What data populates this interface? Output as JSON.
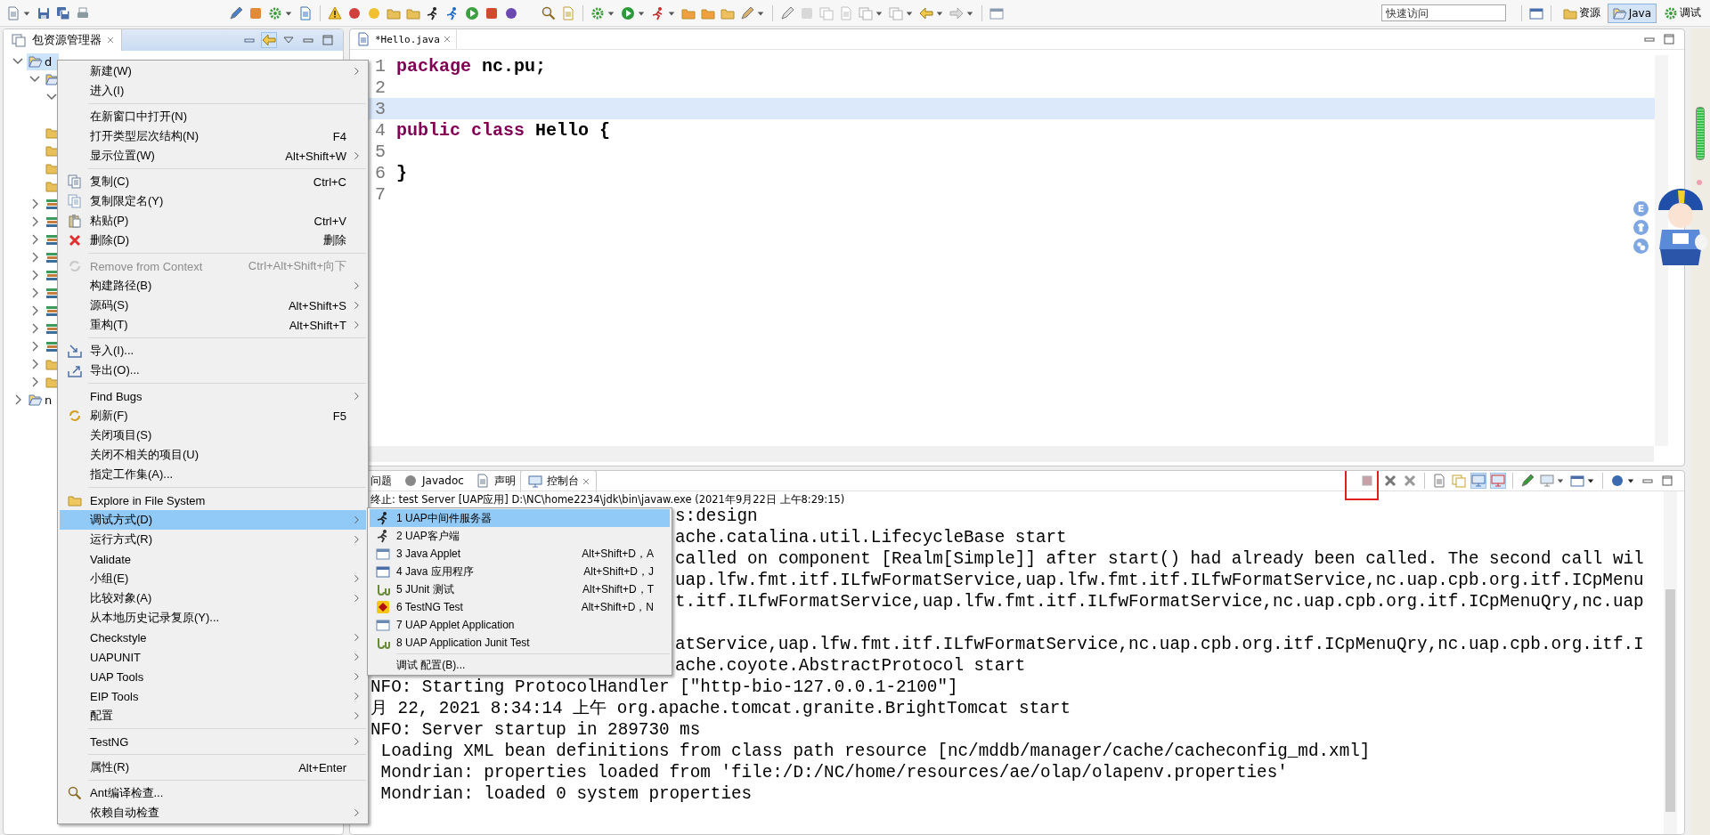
{
  "toolbar": {
    "quick_access": {
      "placeholder": "快速访问"
    },
    "perspectives": [
      {
        "label": "资源",
        "selected": false
      },
      {
        "label": "Java",
        "selected": true
      },
      {
        "label": "调试",
        "selected": false
      }
    ]
  },
  "package_explorer": {
    "title": "包资源管理器",
    "tree": [
      {
        "kind": "project",
        "label": "d",
        "expanded": true,
        "selected": true,
        "children": [
          {
            "kind": "package-folder",
            "expanded": true,
            "selected": false,
            "children": [
              {
                "expanded": true
              }
            ]
          },
          {
            "kind": "folder",
            "selected": false
          },
          {
            "kind": "folder",
            "selected": false
          },
          {
            "kind": "folder",
            "selected": false
          },
          {
            "kind": "folder",
            "selected": false
          },
          {
            "kind": "library",
            "expanded": false,
            "selected": false
          },
          {
            "kind": "library",
            "expanded": false,
            "selected": false
          },
          {
            "kind": "library",
            "expanded": false,
            "selected": false
          },
          {
            "kind": "library",
            "expanded": false,
            "selected": false
          },
          {
            "kind": "library",
            "expanded": false,
            "selected": false
          },
          {
            "kind": "library",
            "expanded": false,
            "selected": false
          },
          {
            "kind": "library",
            "expanded": false,
            "selected": false
          },
          {
            "kind": "library",
            "expanded": false,
            "selected": false
          },
          {
            "kind": "library",
            "expanded": false,
            "selected": false
          },
          {
            "kind": "folder",
            "expanded": false,
            "selected": false
          },
          {
            "kind": "folder",
            "expanded": false,
            "selected": false
          }
        ]
      },
      {
        "kind": "project",
        "label": "n",
        "expanded": false,
        "selected": false
      }
    ]
  },
  "editor": {
    "tab": {
      "title": "*Hello.java"
    },
    "lines": [
      {
        "number": "1",
        "current": false,
        "tokens": [
          {
            "kind": "keyword",
            "text": "package"
          },
          {
            "kind": "plain",
            "text": " nc.pu;"
          }
        ]
      },
      {
        "number": "2",
        "current": false
      },
      {
        "number": "3",
        "current": true
      },
      {
        "number": "4",
        "current": false,
        "tokens": [
          {
            "kind": "keyword",
            "text": "public class"
          },
          {
            "kind": "plain",
            "text": " Hello {"
          }
        ]
      },
      {
        "number": "5",
        "current": false
      },
      {
        "number": "6",
        "current": false,
        "tokens": [
          {
            "kind": "plain",
            "text": "}"
          }
        ]
      },
      {
        "number": "7",
        "current": false
      }
    ]
  },
  "console": {
    "tabs": [
      {
        "label": "问题",
        "selected": false
      },
      {
        "label": "Javadoc",
        "selected": false
      },
      {
        "label": "声明",
        "selected": false
      },
      {
        "label": "控制台",
        "selected": true
      }
    ],
    "header": "终止: test Server [UAP应用] D:\\NC\\home2234\\jdk\\bin\\javaw.exe (2021年9月22日 上午8:29:15)",
    "lines_beside_submenu": [
      {
        "text": "s:design"
      },
      {
        "text": "ache.catalina.util.LifecycleBase start"
      },
      {
        "text": "called on component [Realm[Simple]] after start() had already been called. The second call wil"
      },
      {
        "text": "uap.lfw.fmt.itf.ILfwFormatService,uap.lfw.fmt.itf.ILfwFormatService,nc.uap.cpb.org.itf.ICpMenu"
      },
      {
        "text": "t.itf.ILfwFormatService,uap.lfw.fmt.itf.ILfwFormatService,nc.uap.cpb.org.itf.ICpMenuQry,nc.uap"
      },
      {
        "text": "atService,uap.lfw.fmt.itf.ILfwFormatService,nc.uap.cpb.org.itf.ICpMenuQry,nc.uap.cpb.org.itf.I"
      },
      {
        "text": "ache.coyote.AbstractProtocol start"
      }
    ],
    "lines_below_submenu": [
      {
        "text": "NFO: Starting ProtocolHandler [\"http-bio-127.0.0.1-2100\"]"
      },
      {
        "text": "月 22, 2021 8:34:14 上午 org.apache.tomcat.granite.BrightTomcat start"
      },
      {
        "text": "NFO: Server startup in 289730 ms"
      },
      {
        "text": " Loading XML bean definitions from class path resource [nc/mddb/manager/cache/cacheconfig_md.xml]"
      },
      {
        "text": " Mondrian: properties loaded from 'file:/D:/NC/home/resources/ae/olap/olapenv.properties'"
      },
      {
        "text": " Mondrian: loaded 0 system properties"
      }
    ]
  },
  "context_menu": {
    "items": [
      {
        "kind": "item",
        "label": "新建(W)",
        "submenu": true,
        "selected": false,
        "disabled": false
      },
      {
        "kind": "item",
        "label": "进入(I)",
        "submenu": false,
        "selected": false,
        "disabled": false
      },
      {
        "kind": "separator"
      },
      {
        "kind": "item",
        "label": "在新窗口中打开(N)",
        "submenu": false,
        "selected": false,
        "disabled": false
      },
      {
        "kind": "item",
        "label": "打开类型层次结构(N)",
        "shortcut": "F4",
        "submenu": false,
        "selected": false,
        "disabled": false
      },
      {
        "kind": "item",
        "label": "显示位置(W)",
        "shortcut": "Alt+Shift+W",
        "submenu": true,
        "selected": false,
        "disabled": false
      },
      {
        "kind": "separator"
      },
      {
        "kind": "item",
        "label": "复制(C)",
        "shortcut": "Ctrl+C",
        "submenu": false,
        "selected": false,
        "disabled": false
      },
      {
        "kind": "item",
        "label": "复制限定名(Y)",
        "submenu": false,
        "selected": false,
        "disabled": false
      },
      {
        "kind": "item",
        "label": "粘贴(P)",
        "shortcut": "Ctrl+V",
        "submenu": false,
        "selected": false,
        "disabled": false
      },
      {
        "kind": "item",
        "label": "删除(D)",
        "shortcut": "删除",
        "submenu": false,
        "selected": false,
        "disabled": false
      },
      {
        "kind": "separator"
      },
      {
        "kind": "item",
        "label": "Remove from Context",
        "shortcut": "Ctrl+Alt+Shift+向下",
        "submenu": false,
        "selected": false,
        "disabled": true
      },
      {
        "kind": "item",
        "label": "构建路径(B)",
        "submenu": true,
        "selected": false,
        "disabled": false
      },
      {
        "kind": "item",
        "label": "源码(S)",
        "shortcut": "Alt+Shift+S",
        "submenu": true,
        "selected": false,
        "disabled": false
      },
      {
        "kind": "item",
        "label": "重构(T)",
        "shortcut": "Alt+Shift+T",
        "submenu": true,
        "selected": false,
        "disabled": false
      },
      {
        "kind": "separator"
      },
      {
        "kind": "item",
        "label": "导入(I)...",
        "submenu": false,
        "selected": false,
        "disabled": false
      },
      {
        "kind": "item",
        "label": "导出(O)...",
        "submenu": false,
        "selected": false,
        "disabled": false
      },
      {
        "kind": "separator"
      },
      {
        "kind": "item",
        "label": "Find Bugs",
        "submenu": true,
        "selected": false,
        "disabled": false
      },
      {
        "kind": "item",
        "label": "刷新(F)",
        "shortcut": "F5",
        "submenu": false,
        "selected": false,
        "disabled": false
      },
      {
        "kind": "item",
        "label": "关闭项目(S)",
        "submenu": false,
        "selected": false,
        "disabled": false
      },
      {
        "kind": "item",
        "label": "关闭不相关的项目(U)",
        "submenu": false,
        "selected": false,
        "disabled": false
      },
      {
        "kind": "item",
        "label": "指定工作集(A)...",
        "submenu": false,
        "selected": false,
        "disabled": false
      },
      {
        "kind": "separator"
      },
      {
        "kind": "item",
        "label": "Explore in File System",
        "submenu": false,
        "selected": false,
        "disabled": false
      },
      {
        "kind": "item",
        "label": "调试方式(D)",
        "submenu": true,
        "selected": true,
        "disabled": false
      },
      {
        "kind": "item",
        "label": "运行方式(R)",
        "submenu": true,
        "selected": false,
        "disabled": false
      },
      {
        "kind": "item",
        "label": "Validate",
        "submenu": false,
        "selected": false,
        "disabled": false
      },
      {
        "kind": "item",
        "label": "小组(E)",
        "submenu": true,
        "selected": false,
        "disabled": false
      },
      {
        "kind": "item",
        "label": "比较对象(A)",
        "submenu": true,
        "selected": false,
        "disabled": false
      },
      {
        "kind": "item",
        "label": "从本地历史记录复原(Y)...",
        "submenu": false,
        "selected": false,
        "disabled": false
      },
      {
        "kind": "item",
        "label": "Checkstyle",
        "submenu": true,
        "selected": false,
        "disabled": false
      },
      {
        "kind": "item",
        "label": "UAPUNIT",
        "submenu": true,
        "selected": false,
        "disabled": false
      },
      {
        "kind": "item",
        "label": "UAP Tools",
        "submenu": true,
        "selected": false,
        "disabled": false
      },
      {
        "kind": "item",
        "label": "EIP Tools",
        "submenu": true,
        "selected": false,
        "disabled": false
      },
      {
        "kind": "item",
        "label": "配置",
        "submenu": true,
        "selected": false,
        "disabled": false
      },
      {
        "kind": "separator"
      },
      {
        "kind": "item",
        "label": "TestNG",
        "submenu": true,
        "selected": false,
        "disabled": false
      },
      {
        "kind": "separator"
      },
      {
        "kind": "item",
        "label": "属性(R)",
        "shortcut": "Alt+Enter",
        "submenu": false,
        "selected": false,
        "disabled": false
      },
      {
        "kind": "separator"
      },
      {
        "kind": "item",
        "label": "Ant编译检查...",
        "submenu": false,
        "selected": false,
        "disabled": false
      },
      {
        "kind": "item",
        "label": "依赖自动检查",
        "submenu": true,
        "selected": false,
        "disabled": false
      }
    ]
  },
  "submenu": {
    "items": [
      {
        "kind": "item",
        "label": "1 UAP中间件服务器",
        "selected": true
      },
      {
        "kind": "item",
        "label": "2 UAP客户端",
        "selected": false
      },
      {
        "kind": "item",
        "label": "3 Java Applet",
        "shortcut": "Alt+Shift+D，A",
        "selected": false
      },
      {
        "kind": "item",
        "label": "4 Java 应用程序",
        "shortcut": "Alt+Shift+D，J",
        "selected": false
      },
      {
        "kind": "item",
        "label": "5 JUnit 测试",
        "shortcut": "Alt+Shift+D，T",
        "selected": false
      },
      {
        "kind": "item",
        "label": "6 TestNG Test",
        "shortcut": "Alt+Shift+D，N",
        "selected": false
      },
      {
        "kind": "item",
        "label": "7 UAP Applet Application",
        "selected": false
      },
      {
        "kind": "item",
        "label": "8 UAP Application Junit Test",
        "selected": false
      },
      {
        "kind": "separator"
      },
      {
        "kind": "item",
        "label": "调试 配置(B)...",
        "selected": false
      }
    ]
  },
  "assistant": {
    "buttons": [
      {
        "kind": "letter",
        "label": "E"
      },
      {
        "kind": "shirt"
      },
      {
        "kind": "chat"
      }
    ]
  }
}
